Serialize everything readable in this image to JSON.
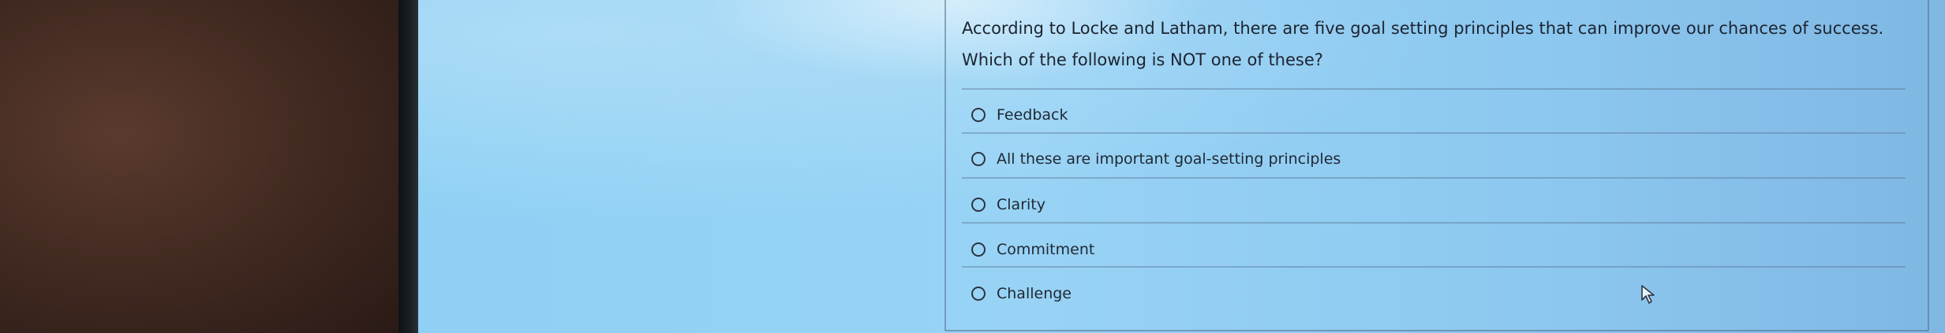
{
  "question": {
    "text": "According to Locke and Latham, there are five goal setting principles that can improve our chances of success. Which of the following is NOT one of these?"
  },
  "options": [
    {
      "label": "Feedback"
    },
    {
      "label": "All these are important goal-setting principles"
    },
    {
      "label": "Clarity"
    },
    {
      "label": "Commitment"
    },
    {
      "label": "Challenge"
    }
  ],
  "icons": {
    "cursor": "mouse-pointer-icon",
    "radio": "radio-unselected-icon"
  },
  "colors": {
    "text": "#1c2430",
    "screen_background": "#8fd0f4"
  }
}
